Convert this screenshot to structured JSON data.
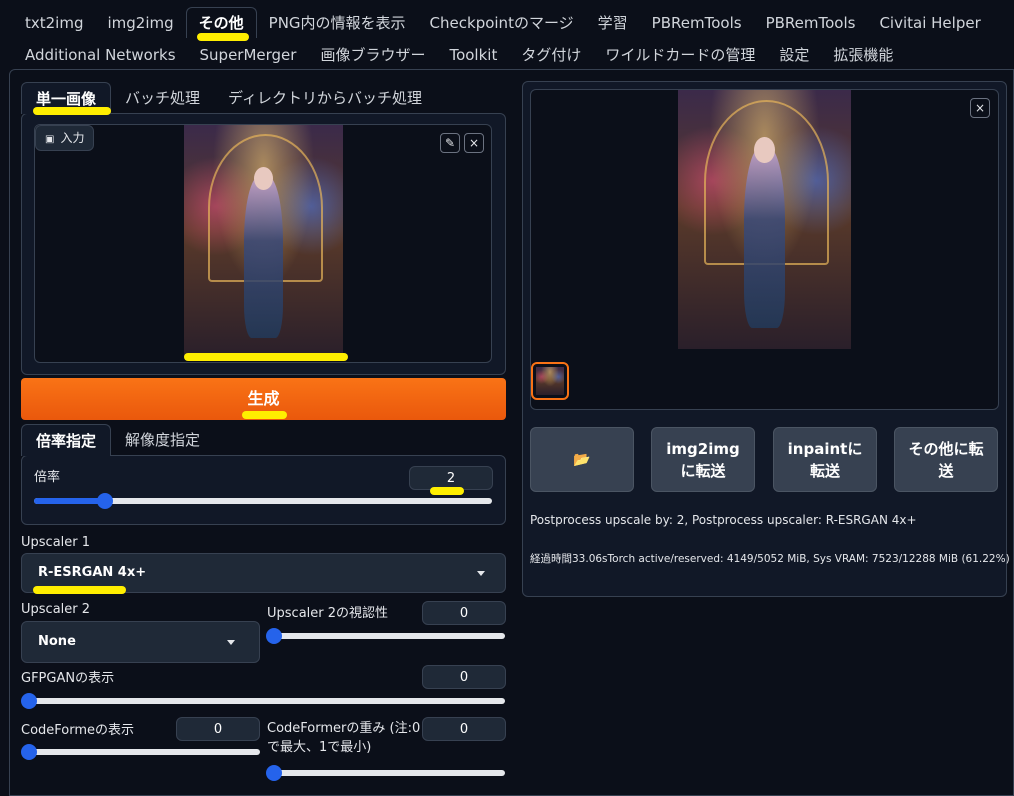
{
  "top_tabs_row1": [
    "txt2img",
    "img2img",
    "その他",
    "PNG内の情報を表示",
    "Checkpointのマージ",
    "学習",
    "PBRemTools",
    "PBRemTools",
    "Civitai Helper"
  ],
  "top_tabs_row2": [
    "Additional Networks",
    "SuperMerger",
    "画像ブラウザー",
    "Toolkit",
    "タグ付け",
    "ワイルドカードの管理",
    "設定",
    "拡張機能"
  ],
  "left": {
    "source_tabs": [
      "単一画像",
      "バッチ処理",
      "ディレクトリからバッチ処理"
    ],
    "input_label": "入力",
    "generate_label": "生成",
    "resize_tabs": [
      "倍率指定",
      "解像度指定"
    ],
    "scale_label": "倍率",
    "scale_value": "2",
    "scale_fraction": 0.14,
    "upscaler1_label": "Upscaler 1",
    "upscaler1_value": "R-ESRGAN 4x+",
    "upscaler2_label": "Upscaler 2",
    "upscaler2_value": "None",
    "upscaler2_vis_label": "Upscaler 2の視認性",
    "upscaler2_vis_value": "0",
    "gfpgan_label": "GFPGANの表示",
    "gfpgan_value": "0",
    "codeformer_vis_label": "CodeFormeの表示",
    "codeformer_vis_value": "0",
    "codeformer_weight_label": "CodeFormerの重み (注:0で最大、1で最小)",
    "codeformer_weight_value": "0"
  },
  "right": {
    "buttons": [
      "📂",
      "img2img に転送",
      "inpaintに 転送",
      "その他に転 送"
    ],
    "info_text": "Postprocess upscale by: 2, Postprocess upscaler: R-ESRGAN 4x+",
    "timing_text": "経過時間33.06sTorch active/reserved: 4149/5052 MiB, Sys VRAM: 7523/12288 MiB (61.22%)"
  },
  "colors": {
    "accent": "#ea580c",
    "slider": "#2563eb",
    "highlight": "#ffee00"
  },
  "icons": {
    "close": "×",
    "edit": "✎",
    "image": "▣",
    "folder": "📂"
  }
}
